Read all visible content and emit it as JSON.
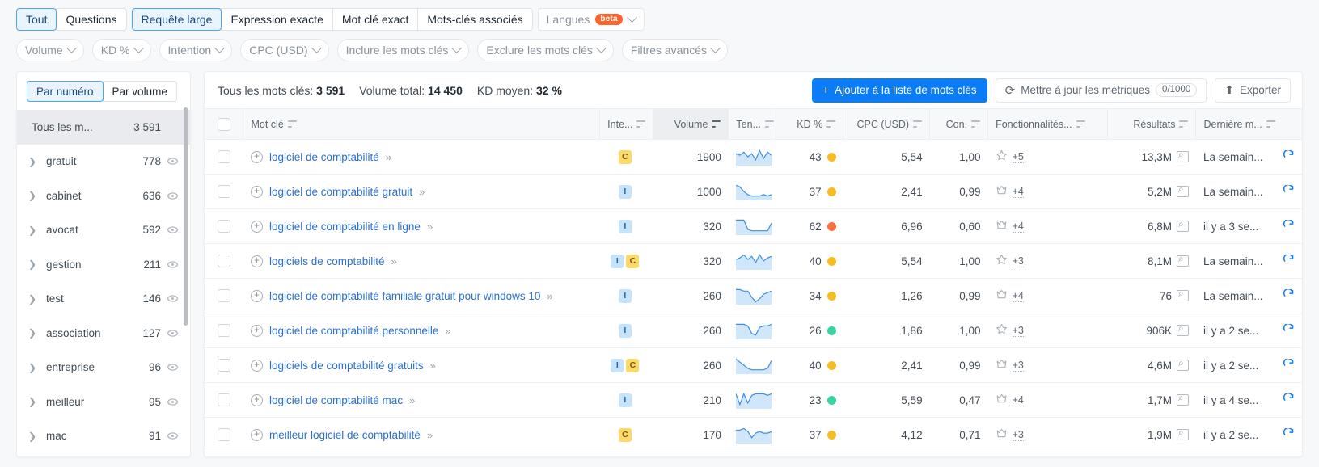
{
  "filters": {
    "match_tabs": [
      {
        "label": "Tout",
        "active": true
      },
      {
        "label": "Questions",
        "active": false
      }
    ],
    "match_tabs2": [
      {
        "label": "Requête large",
        "active": true
      },
      {
        "label": "Expression exacte",
        "active": false
      },
      {
        "label": "Mot clé exact",
        "active": false
      },
      {
        "label": "Mots-clés associés",
        "active": false
      }
    ],
    "languages": {
      "label": "Langues",
      "badge": "beta"
    },
    "dropdowns": [
      {
        "label": "Volume"
      },
      {
        "label": "KD %"
      },
      {
        "label": "Intention"
      },
      {
        "label": "CPC (USD)"
      },
      {
        "label": "Inclure les mots clés"
      },
      {
        "label": "Exclure les mots clés"
      },
      {
        "label": "Filtres avancés"
      }
    ]
  },
  "sidebar": {
    "toggle": [
      {
        "label": "Par numéro",
        "active": true
      },
      {
        "label": "Par volume",
        "active": false
      }
    ],
    "all_label": "Tous les m...",
    "all_count": "3 591",
    "items": [
      {
        "label": "gratuit",
        "count": "778"
      },
      {
        "label": "cabinet",
        "count": "636"
      },
      {
        "label": "avocat",
        "count": "592"
      },
      {
        "label": "gestion",
        "count": "211"
      },
      {
        "label": "test",
        "count": "146"
      },
      {
        "label": "association",
        "count": "127"
      },
      {
        "label": "entreprise",
        "count": "96"
      },
      {
        "label": "meilleur",
        "count": "95"
      },
      {
        "label": "mac",
        "count": "91"
      }
    ]
  },
  "toolbar": {
    "total_keywords_label": "Tous les mots clés:",
    "total_keywords_value": "3 591",
    "total_volume_label": "Volume total:",
    "total_volume_value": "14 450",
    "avg_kd_label": "KD moyen:",
    "avg_kd_value": "32 %",
    "add_button": "Ajouter à la liste de mots clés",
    "update_button": "Mettre à jour les métriques",
    "update_counter": "0/1000",
    "export_button": "Exporter"
  },
  "table": {
    "columns": [
      {
        "key": "kw",
        "label": "Mot clé",
        "align": "left",
        "sorted": false
      },
      {
        "key": "intent",
        "label": "Inte...",
        "align": "left",
        "sorted": false
      },
      {
        "key": "volume",
        "label": "Volume",
        "align": "right",
        "sorted": true
      },
      {
        "key": "trend",
        "label": "Ten...",
        "align": "left",
        "sorted": false
      },
      {
        "key": "kd",
        "label": "KD %",
        "align": "right",
        "sorted": false
      },
      {
        "key": "cpc",
        "label": "CPC (USD)",
        "align": "right",
        "sorted": false
      },
      {
        "key": "com",
        "label": "Con.",
        "align": "right",
        "sorted": false
      },
      {
        "key": "feat",
        "label": "Fonctionnalités...",
        "align": "left",
        "sorted": false
      },
      {
        "key": "res",
        "label": "Résultats",
        "align": "right",
        "sorted": false
      },
      {
        "key": "upd",
        "label": "Dernière m...",
        "align": "left",
        "sorted": false
      }
    ],
    "rows": [
      {
        "kw": "logiciel de comptabilité",
        "intents": [
          "c"
        ],
        "volume": "1900",
        "trend": [
          7,
          6,
          8,
          5,
          7,
          3,
          9,
          4,
          8,
          6
        ],
        "kd": "43",
        "kd_color": "#f5bd21",
        "cpc": "5,54",
        "com": "1,00",
        "feat_icon": "star-icon",
        "feat": "+5",
        "res": "13,3M",
        "upd": "La semain..."
      },
      {
        "kw": "logiciel de comptabilité gratuit",
        "intents": [
          "i"
        ],
        "volume": "1000",
        "trend": [
          9,
          8,
          5,
          3,
          2,
          2,
          2,
          3,
          2,
          3
        ],
        "kd": "37",
        "kd_color": "#f5bd21",
        "cpc": "2,41",
        "com": "0,99",
        "feat_icon": "crown-icon",
        "feat": "+4",
        "res": "5,2M",
        "upd": "La semain..."
      },
      {
        "kw": "logiciel de comptabilité en ligne",
        "intents": [
          "i"
        ],
        "volume": "320",
        "trend": [
          9,
          9,
          9,
          3,
          2,
          2,
          2,
          2,
          2,
          7
        ],
        "kd": "62",
        "kd_color": "#f96f3f",
        "cpc": "6,96",
        "com": "0,60",
        "feat_icon": "crown-icon",
        "feat": "+4",
        "res": "6,8M",
        "upd": "il y a 3 se..."
      },
      {
        "kw": "logiciels de comptabilité",
        "intents": [
          "i",
          "c"
        ],
        "volume": "320",
        "trend": [
          6,
          7,
          9,
          6,
          8,
          4,
          9,
          5,
          7,
          8
        ],
        "kd": "40",
        "kd_color": "#f5bd21",
        "cpc": "5,54",
        "com": "1,00",
        "feat_icon": "star-icon",
        "feat": "+3",
        "res": "8,1M",
        "upd": "La semain..."
      },
      {
        "kw": "logiciel de comptabilité familiale gratuit pour windows 10",
        "intents": [
          "i"
        ],
        "volume": "260",
        "trend": [
          9,
          9,
          8,
          8,
          4,
          1,
          3,
          6,
          7,
          8
        ],
        "kd": "34",
        "kd_color": "#f5bd21",
        "cpc": "1,26",
        "com": "0,99",
        "feat_icon": "crown-icon",
        "feat": "+4",
        "res": "76",
        "upd": "La semain..."
      },
      {
        "kw": "logiciel de comptabilité personnelle",
        "intents": [
          "i"
        ],
        "volume": "260",
        "trend": [
          9,
          9,
          9,
          8,
          3,
          2,
          7,
          8,
          8,
          9
        ],
        "kd": "26",
        "kd_color": "#3ad29f",
        "cpc": "1,86",
        "com": "1,00",
        "feat_icon": "star-icon",
        "feat": "+3",
        "res": "906K",
        "upd": "il y a 2 se..."
      },
      {
        "kw": "logiciels de comptabilité gratuits",
        "intents": [
          "i",
          "c"
        ],
        "volume": "260",
        "trend": [
          9,
          7,
          5,
          3,
          2,
          2,
          2,
          2,
          3,
          8
        ],
        "kd": "40",
        "kd_color": "#f5bd21",
        "cpc": "2,41",
        "com": "0,99",
        "feat_icon": "crown-icon",
        "feat": "+3",
        "res": "4,6M",
        "upd": "il y a 2 se..."
      },
      {
        "kw": "logiciel de comptabilité mac",
        "intents": [
          "i"
        ],
        "volume": "210",
        "trend": [
          9,
          2,
          9,
          3,
          8,
          9,
          9,
          9,
          8,
          9
        ],
        "kd": "23",
        "kd_color": "#3ad29f",
        "cpc": "5,59",
        "com": "0,47",
        "feat_icon": "crown-icon",
        "feat": "+4",
        "res": "1,7M",
        "upd": "il y a 4 se..."
      },
      {
        "kw": "meilleur logiciel de comptabilité",
        "intents": [
          "c"
        ],
        "volume": "170",
        "trend": [
          8,
          8,
          9,
          7,
          3,
          6,
          7,
          6,
          6,
          7
        ],
        "kd": "37",
        "kd_color": "#f5bd21",
        "cpc": "4,12",
        "com": "0,71",
        "feat_icon": "crown-icon",
        "feat": "+3",
        "res": "1,9M",
        "upd": "il y a 2 se..."
      }
    ]
  }
}
